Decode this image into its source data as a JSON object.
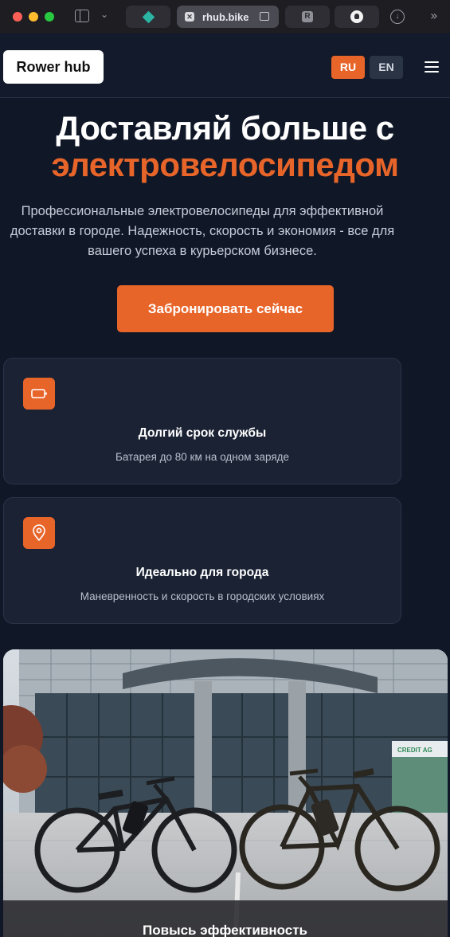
{
  "browser": {
    "tabs": [
      {
        "icon": "diamond-icon",
        "title": ""
      },
      {
        "icon": "close-icon",
        "title": "rhub.bike"
      },
      {
        "icon": "r-icon",
        "title": "R"
      },
      {
        "icon": "github-icon",
        "title": ""
      }
    ]
  },
  "header": {
    "logo": "Rower hub",
    "lang_ru": "RU",
    "lang_en": "EN"
  },
  "hero": {
    "title_line1": "Доставляй больше с",
    "title_line2": "электровелосипедом",
    "subtitle": "Профессиональные электровелосипеды для эффективной доставки в городе. Надежность, скорость и экономия - все для вашего успеха в курьерском бизнесе.",
    "cta": "Забронировать сейчас"
  },
  "features": [
    {
      "icon": "battery-icon",
      "title": "Долгий срок службы",
      "text": "Батарея до 80 км на одном заряде"
    },
    {
      "icon": "map-pin-icon",
      "title": "Идеально для города",
      "text": "Маневренность и скорость в городских условиях"
    }
  ],
  "photo": {
    "caption": "Повысь эффективность",
    "sign_text": "CREDIT AG"
  },
  "colors": {
    "accent": "#e8652a",
    "background": "#101727",
    "card": "#1a2234"
  }
}
